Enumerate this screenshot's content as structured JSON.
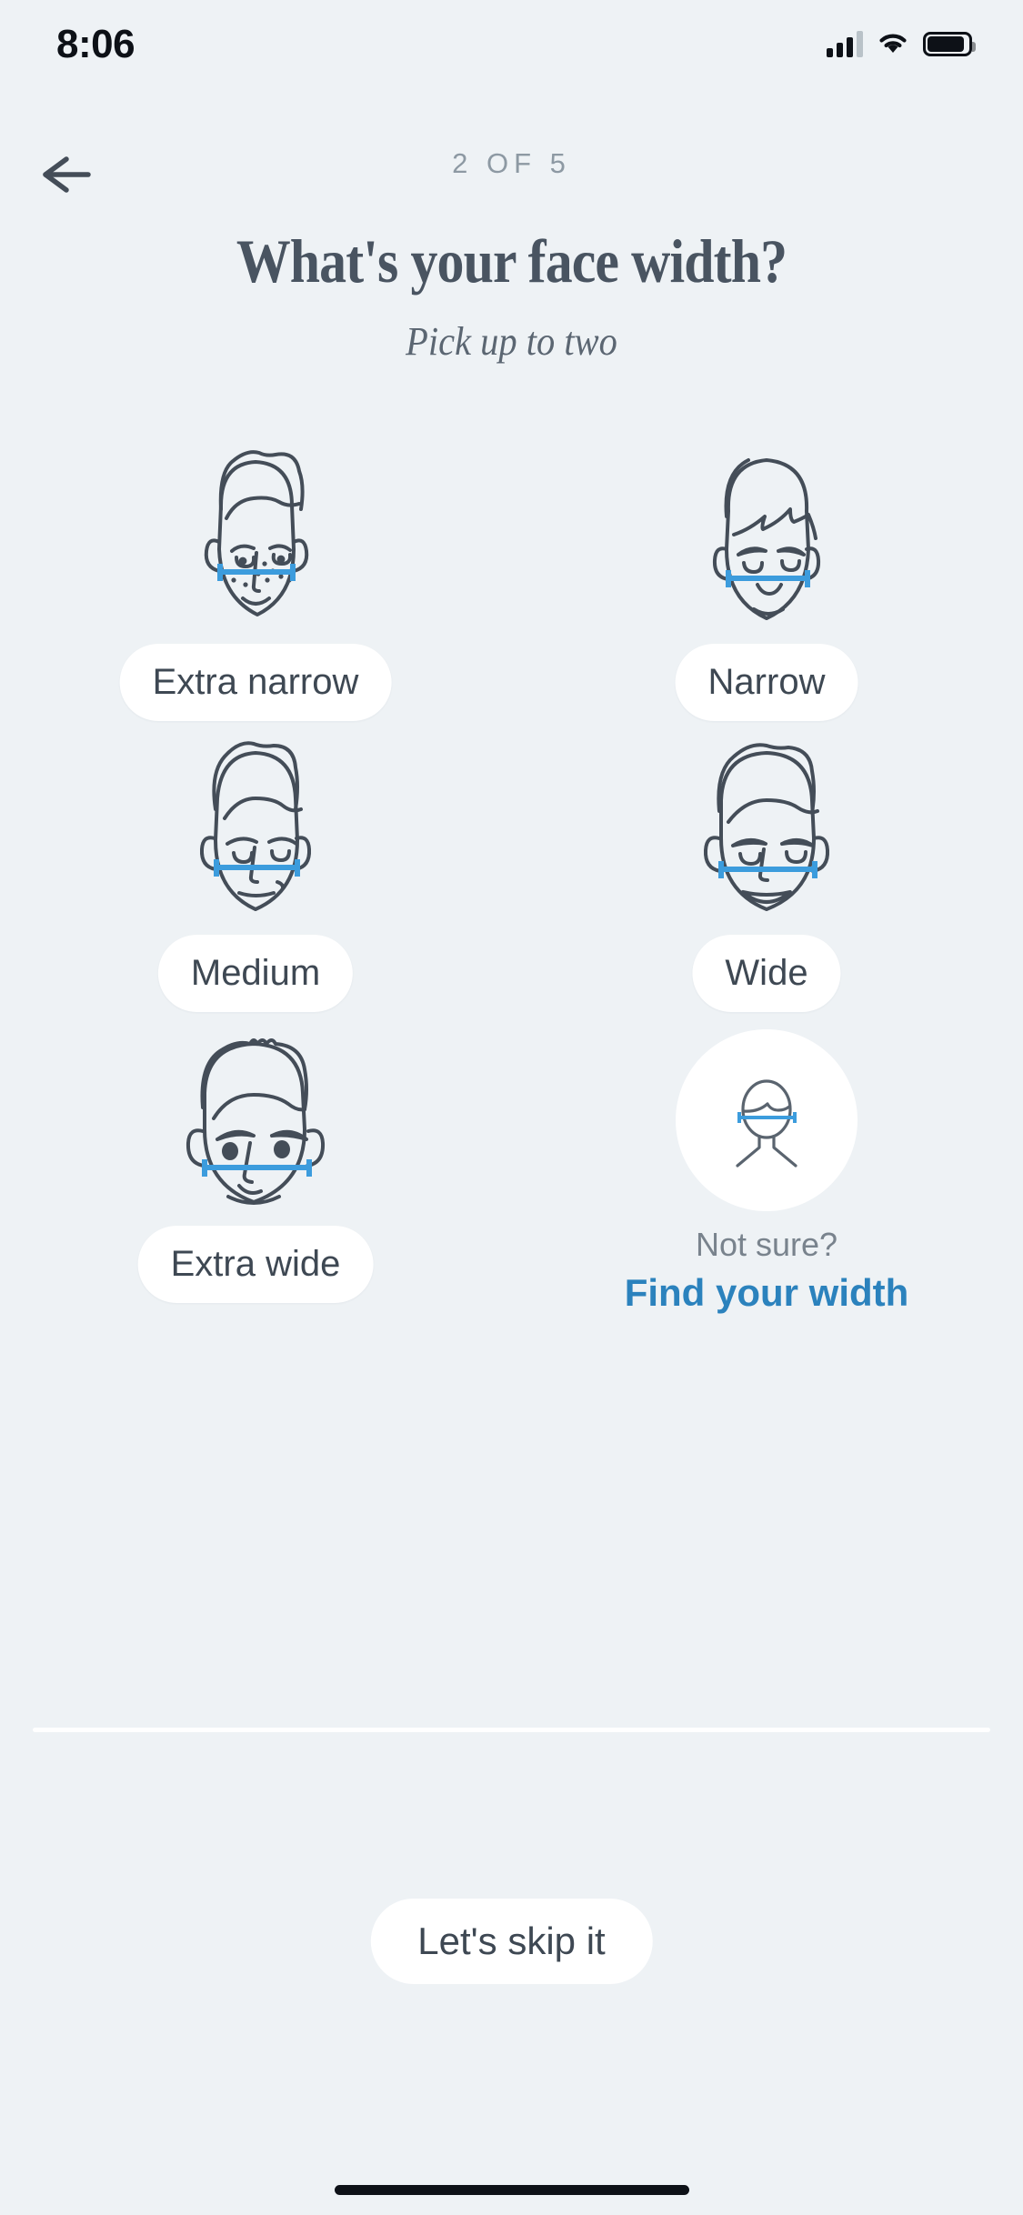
{
  "status_bar": {
    "time": "8:06",
    "signal_icon": "cellular-bars-icon",
    "wifi_icon": "wifi-icon",
    "battery_icon": "battery-icon"
  },
  "nav": {
    "back_icon": "back-arrow-icon",
    "step_indicator": "2 OF 5"
  },
  "header": {
    "title": "What's your face width?",
    "subtitle": "Pick up to two"
  },
  "options": [
    {
      "label": "Extra narrow",
      "icon": "face-extra-narrow-icon",
      "measure_color": "#3c9cdd",
      "selected": false
    },
    {
      "label": "Narrow",
      "icon": "face-narrow-icon",
      "measure_color": "#3c9cdd",
      "selected": false
    },
    {
      "label": "Medium",
      "icon": "face-medium-icon",
      "measure_color": "#3c9cdd",
      "selected": false
    },
    {
      "label": "Wide",
      "icon": "face-wide-icon",
      "measure_color": "#3c9cdd",
      "selected": false
    },
    {
      "label": "Extra wide",
      "icon": "face-extra-wide-icon",
      "measure_color": "#3c9cdd",
      "selected": false
    }
  ],
  "not_sure": {
    "icon": "face-measure-help-icon",
    "question": "Not sure?",
    "link_label": "Find your width",
    "link_color": "#2b82bd"
  },
  "footer": {
    "skip_label": "Let's skip it"
  },
  "colors": {
    "background": "#eef2f5",
    "surface": "#ffffff",
    "text_primary": "#3e4853",
    "text_muted": "#79838d",
    "accent_blue": "#3c9cdd",
    "line_art": "#444d58"
  }
}
